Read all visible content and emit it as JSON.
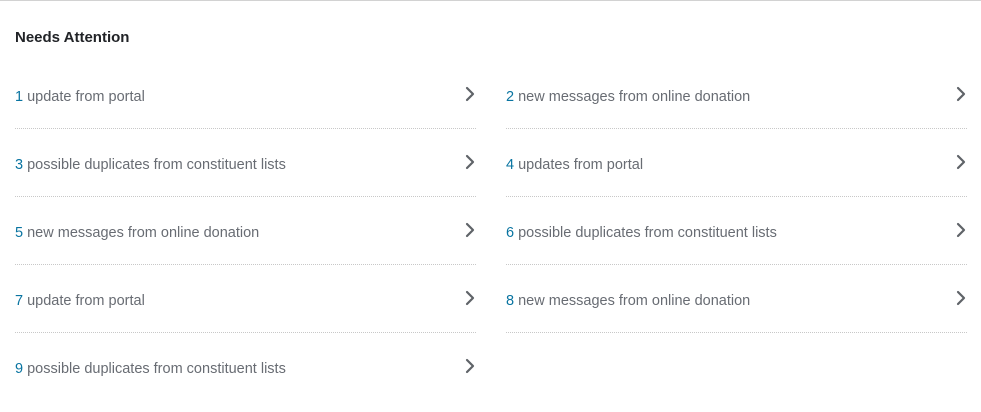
{
  "panel": {
    "title": "Needs Attention",
    "items": [
      {
        "count": "1",
        "text": "update from portal"
      },
      {
        "count": "2",
        "text": "new messages from online donation"
      },
      {
        "count": "3",
        "text": "possible duplicates from constituent lists"
      },
      {
        "count": "4",
        "text": "updates from portal"
      },
      {
        "count": "5",
        "text": "new messages from online donation"
      },
      {
        "count": "6",
        "text": "possible duplicates from constituent lists"
      },
      {
        "count": "7",
        "text": "update from portal"
      },
      {
        "count": "8",
        "text": "new messages from online donation"
      },
      {
        "count": "9",
        "text": "possible duplicates from constituent lists"
      }
    ]
  },
  "icons": {
    "chevron": "chevron-right-icon"
  },
  "colors": {
    "count": "#0974a1",
    "text": "#686c73",
    "title": "#212327",
    "chevron": "#5f6368"
  }
}
